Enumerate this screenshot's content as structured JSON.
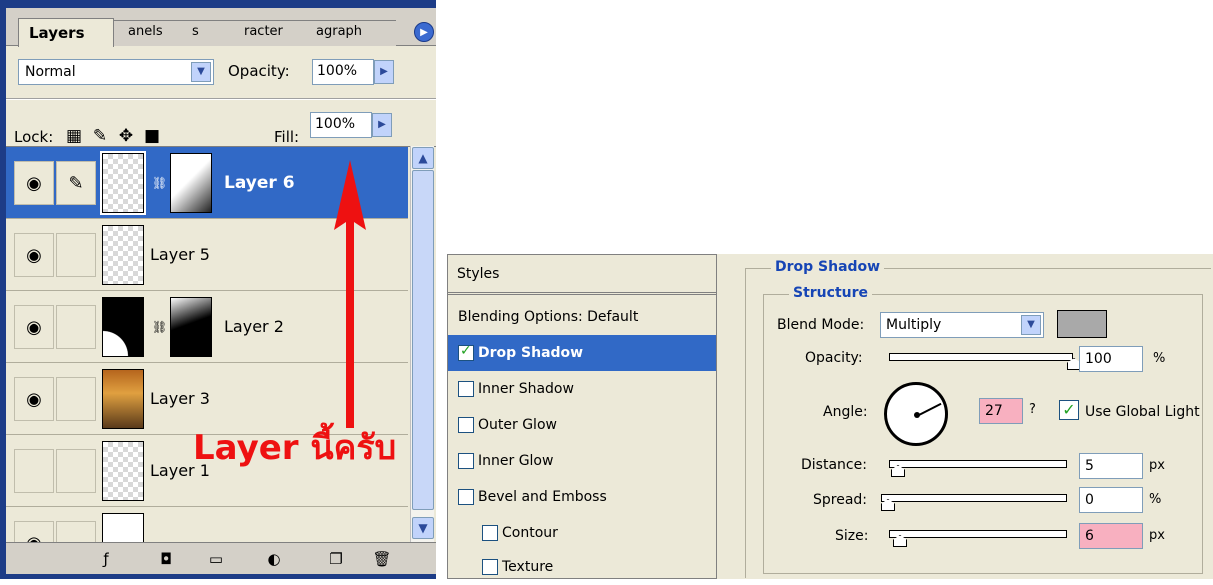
{
  "layers_panel": {
    "tabs": [
      "Layers",
      "anels",
      "s",
      "racter",
      "agraph"
    ],
    "blend_mode": "Normal",
    "opacity_label": "Opacity:",
    "opacity_value": "100%",
    "lock_label": "Lock:",
    "fill_label": "Fill:",
    "fill_value": "100%",
    "layers": [
      {
        "name": "Layer 6",
        "selected": true,
        "visible": true
      },
      {
        "name": "Layer 5",
        "selected": false,
        "visible": true
      },
      {
        "name": "Layer 2",
        "selected": false,
        "visible": true
      },
      {
        "name": "Layer 3",
        "selected": false,
        "visible": true
      },
      {
        "name": "Layer 1",
        "selected": false,
        "visible": false
      }
    ],
    "annotation": "Layer นี้ครับ",
    "annotation_color": "#ee1111",
    "selection_color": "#3169c6"
  },
  "styles_panel": {
    "title": "Styles",
    "items": [
      {
        "label": "Blending Options: Default",
        "has_checkbox": false,
        "checked": false,
        "selected": false
      },
      {
        "label": "Drop Shadow",
        "has_checkbox": true,
        "checked": true,
        "selected": true
      },
      {
        "label": "Inner Shadow",
        "has_checkbox": true,
        "checked": false,
        "selected": false
      },
      {
        "label": "Outer Glow",
        "has_checkbox": true,
        "checked": false,
        "selected": false
      },
      {
        "label": "Inner Glow",
        "has_checkbox": true,
        "checked": false,
        "selected": false
      },
      {
        "label": "Bevel and Emboss",
        "has_checkbox": true,
        "checked": false,
        "selected": false
      },
      {
        "label": "Contour",
        "has_checkbox": true,
        "checked": false,
        "selected": false
      },
      {
        "label": "Texture",
        "has_checkbox": true,
        "checked": false,
        "selected": false
      }
    ]
  },
  "drop_shadow": {
    "title": "Drop Shadow",
    "structure_title": "Structure",
    "blend_mode_label": "Blend Mode:",
    "blend_mode_value": "Multiply",
    "shadow_color": "#a9a9a9",
    "opacity_label": "Opacity:",
    "opacity_value": "100",
    "opacity_unit": "%",
    "angle_label": "Angle:",
    "angle_value": "27",
    "angle_unit": "?",
    "use_global_light_label": "Use Global Light",
    "use_global_light_checked": true,
    "distance_label": "Distance:",
    "distance_value": "5",
    "distance_unit": "px",
    "spread_label": "Spread:",
    "spread_value": "0",
    "spread_unit": "%",
    "size_label": "Size:",
    "size_value": "6",
    "size_unit": "px"
  }
}
